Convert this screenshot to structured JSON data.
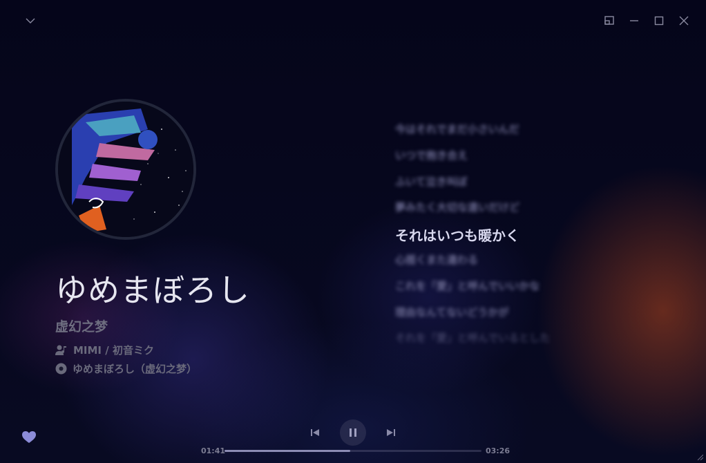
{
  "player": {
    "title": "ゆめまぼろし",
    "subtitle": "虚幻之梦",
    "artists": "MIMI / 初音ミク",
    "album": "ゆめまぼろし（虚幻之梦）",
    "album_display": "ゆめまぼろし（虚幻之梦）",
    "liked": true,
    "accent_color": "#8c8cd8"
  },
  "lyrics": {
    "lines": [
      "今はそれでまだ小さいんだ",
      "いつで抱き合え",
      "ふいて泣き叫ぼ",
      "夢みたく大切な遠いだけど",
      "それはいつも暖かく",
      "心揺くまた違わる",
      "これを「愛」と呼んでいいかな",
      "理由なんてないどうかが",
      "それを「愛」と呼んでいるとした"
    ],
    "active_index": 4
  },
  "playback": {
    "elapsed": "01:41",
    "duration": "03:26",
    "progress": 0.49,
    "state": "playing"
  },
  "window": {
    "collapse_icon": "chevron-down-icon",
    "controls": [
      "mini-player-icon",
      "minimize-icon",
      "maximize-icon",
      "close-icon"
    ]
  }
}
